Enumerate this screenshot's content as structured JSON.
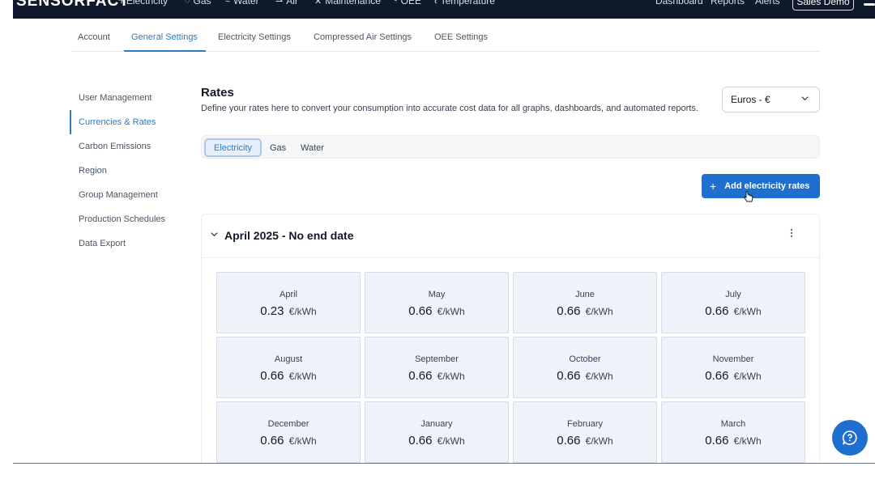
{
  "brand": {
    "logo": "SENSORFACT"
  },
  "topnav": {
    "items": [
      {
        "label": "Electricity",
        "icon": "bolt-icon",
        "glyph": "ϟ"
      },
      {
        "label": "Gas",
        "icon": "flame-icon",
        "glyph": "◌"
      },
      {
        "label": "Water",
        "icon": "water-icon",
        "glyph": "≈"
      },
      {
        "label": "Air",
        "icon": "air-icon",
        "glyph": "⇀"
      },
      {
        "label": "Maintenance",
        "icon": "wrench-icon",
        "glyph": "✕"
      },
      {
        "label": "OEE",
        "icon": "gauge-icon",
        "glyph": "◔"
      },
      {
        "label": "Temperature",
        "icon": "thermometer-icon",
        "glyph": "ℓ"
      }
    ],
    "right_links": [
      "Dashboard",
      "Reports",
      "Alerts"
    ],
    "account_button": "Sales Demo"
  },
  "tabs": [
    "Account",
    "General Settings",
    "Electricity Settings",
    "Compressed Air Settings",
    "OEE Settings"
  ],
  "active_tab": "General Settings",
  "side_menu": [
    "User Management",
    "Currencies & Rates",
    "Carbon Emissions",
    "Region",
    "Group Management",
    "Production Schedules",
    "Data Export"
  ],
  "active_side_item": "Currencies & Rates",
  "rates": {
    "title": "Rates",
    "description": "Define your rates here to convert your consumption into accurate cost data for all graphs, dashboards, and automated reports.",
    "currency_select": "Euros - €",
    "utility_tabs": [
      "Electricity",
      "Gas",
      "Water"
    ],
    "active_utility": "Electricity",
    "add_button": "Add electricity rates",
    "period": {
      "title": "April 2025 - No end date",
      "months": [
        {
          "name": "April",
          "value": "0.23",
          "unit": "€/kWh"
        },
        {
          "name": "May",
          "value": "0.66",
          "unit": "€/kWh"
        },
        {
          "name": "June",
          "value": "0.66",
          "unit": "€/kWh"
        },
        {
          "name": "July",
          "value": "0.66",
          "unit": "€/kWh"
        },
        {
          "name": "August",
          "value": "0.66",
          "unit": "€/kWh"
        },
        {
          "name": "September",
          "value": "0.66",
          "unit": "€/kWh"
        },
        {
          "name": "October",
          "value": "0.66",
          "unit": "€/kWh"
        },
        {
          "name": "November",
          "value": "0.66",
          "unit": "€/kWh"
        },
        {
          "name": "December",
          "value": "0.66",
          "unit": "€/kWh"
        },
        {
          "name": "January",
          "value": "0.66",
          "unit": "€/kWh"
        },
        {
          "name": "February",
          "value": "0.66",
          "unit": "€/kWh"
        },
        {
          "name": "March",
          "value": "0.66",
          "unit": "€/kWh"
        }
      ]
    }
  },
  "colors": {
    "accent": "#2d7cc4",
    "primary_button": "#1f6fd1",
    "navbar": "#0e1a2b",
    "rate_tile": "#eef3fa"
  }
}
